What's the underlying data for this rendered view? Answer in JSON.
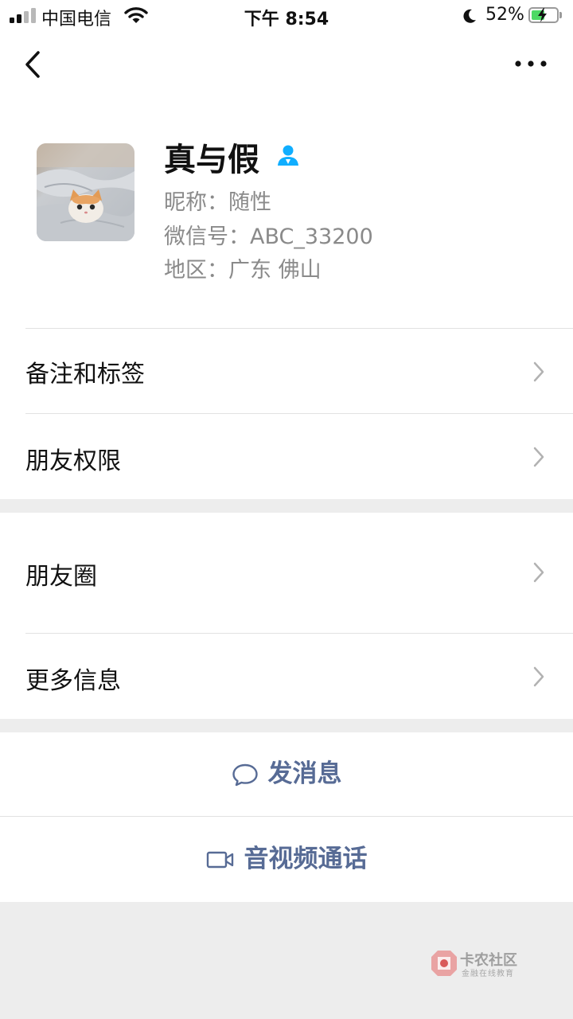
{
  "status_bar": {
    "carrier": "中国电信",
    "time": "下午 8:54",
    "battery_percent": "52%",
    "battery_level": 0.52,
    "charging": true
  },
  "nav": {
    "back_icon": "chevron-left-icon",
    "more_icon": "more-dots-icon"
  },
  "profile": {
    "name": "真与假",
    "nickname": "昵称：随性",
    "wechat_id": "微信号：ABC_33200",
    "region": "地区：广东 佛山",
    "badge_icon": "contact-person-icon",
    "badge_color": "#10aeff"
  },
  "menu": {
    "remark_tags": "备注和标签",
    "friend_permissions": "朋友权限",
    "moments": "朋友圈",
    "more_info": "更多信息"
  },
  "actions": {
    "send_message": "发消息",
    "video_call": "音视频通话",
    "link_color": "#576b95"
  },
  "watermark": {
    "title": "卡农社区",
    "subtitle": "金融在线教育"
  }
}
